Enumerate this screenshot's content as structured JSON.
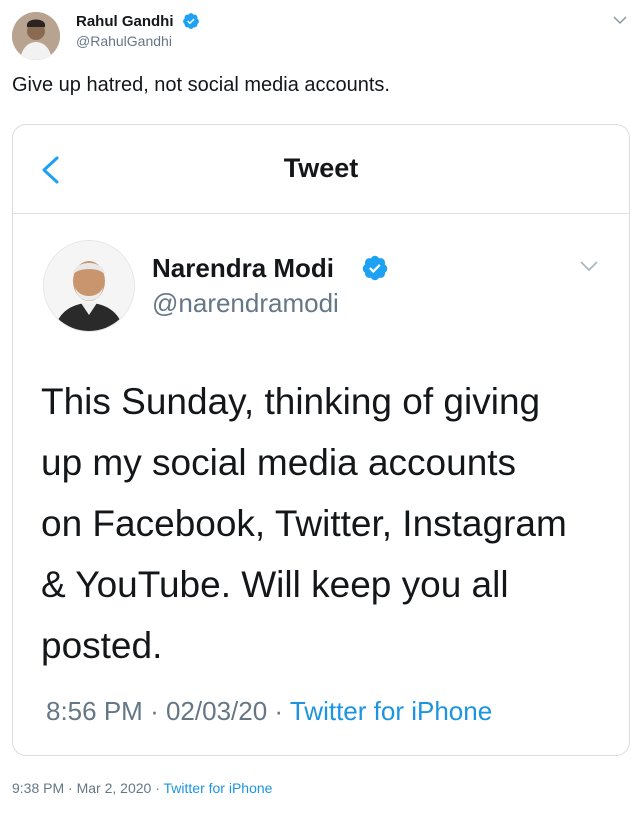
{
  "tweet": {
    "author": {
      "name": "Rahul Gandhi",
      "handle": "@RahulGandhi",
      "verified": true
    },
    "text": "Give up hatred, not social media accounts.",
    "meta": {
      "time": "9:38 PM",
      "date": "Mar 2, 2020",
      "source": "Twitter for iPhone",
      "separator": "·"
    }
  },
  "embedded": {
    "header_title": "Tweet",
    "author": {
      "name": "Narendra Modi",
      "handle": "@narendramodi",
      "verified": true
    },
    "text_lines": [
      "This Sunday, thinking of giving",
      "up my social media accounts",
      "on Facebook, Twitter, Instagram",
      "& YouTube. Will keep you all",
      "posted."
    ],
    "meta": {
      "time": "8:56 PM",
      "date": "02/03/20",
      "source": "Twitter for iPhone",
      "separator": "·"
    }
  },
  "colors": {
    "accent": "#1da1f2",
    "link": "#1b95e0",
    "muted": "#657786",
    "text": "#14171a"
  },
  "icons": [
    "verified-badge-icon",
    "chevron-down-icon",
    "back-arrow-icon"
  ]
}
